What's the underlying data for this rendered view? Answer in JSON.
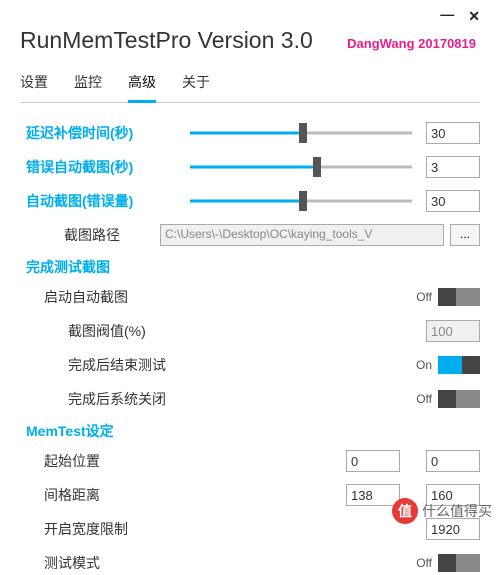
{
  "window": {
    "min_glyph": "—",
    "close_glyph": "✕"
  },
  "header": {
    "title": "RunMemTestPro Version 3.0",
    "credit": "DangWang  20170819"
  },
  "tabs": [
    "设置",
    "监控",
    "高级",
    "关于"
  ],
  "active_tab": 2,
  "sliders": {
    "delay_comp": {
      "label": "延迟补偿时间(秒)",
      "value": "30",
      "pct": 51
    },
    "err_shot": {
      "label": "错误自动截图(秒)",
      "value": "3",
      "pct": 57
    },
    "auto_shot": {
      "label": "自动截图(错误量)",
      "value": "30",
      "pct": 51
    }
  },
  "screenshot": {
    "path_label": "截图路径",
    "path_value": "C:\\Users\\-\\Desktop\\OC\\kaying_tools_V",
    "browse": "..."
  },
  "finish": {
    "section": "完成测试截图",
    "auto_label": "启动自动截图",
    "auto_state": "Off",
    "threshold_label": "截图阀值(%)",
    "threshold_value": "100",
    "end_test_label": "完成后结束测试",
    "end_test_state": "On",
    "shutdown_label": "完成后系统关闭",
    "shutdown_state": "Off"
  },
  "memtest": {
    "section": "MemTest设定",
    "start_label": "起始位置",
    "start_x": "0",
    "start_y": "0",
    "gap_label": "间格距离",
    "gap_x": "138",
    "gap_y": "160",
    "width_label": "开启宽度限制",
    "width_value": "1920",
    "mode_label": "测试模式",
    "mode_state": "Off"
  },
  "watermark": {
    "badge": "值",
    "text": "什么值得买"
  }
}
